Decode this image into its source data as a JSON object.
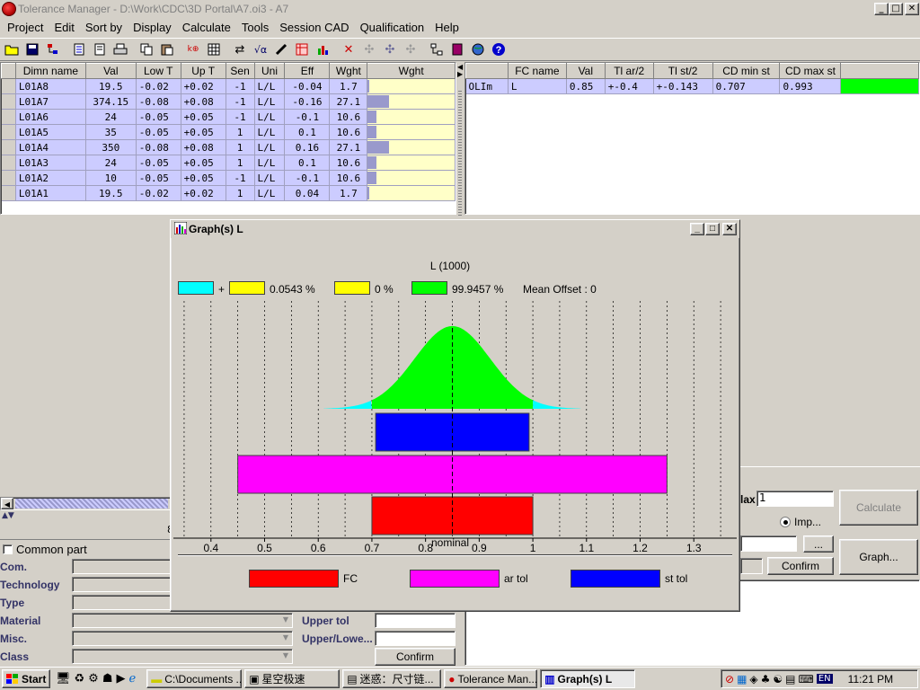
{
  "window": {
    "title": "Tolerance Manager - D:\\Work\\CDC\\3D Portal\\A7.oi3 - A7",
    "min": "_",
    "max": "□",
    "close": "✕"
  },
  "menu": [
    "Project",
    "Edit",
    "Sort by",
    "Display",
    "Calculate",
    "Tools",
    "Session CAD",
    "Qualification",
    "Help"
  ],
  "toolbar_icons": [
    "open-icon",
    "save-icon",
    "tree-icon",
    "print-preview-icon",
    "print-icon",
    "printer-icon",
    "copy-icon",
    "paste-icon",
    "tolerance-icon",
    "grid-icon",
    "swap-icon",
    "sqrt-icon",
    "ruler-icon",
    "table-icon",
    "chart-icon",
    "delete-icon",
    "disabled-icon-1",
    "disabled-icon-2",
    "disabled-icon-3",
    "network-icon",
    "book-icon",
    "globe-icon",
    "help-icon"
  ],
  "dims": {
    "headers": [
      "Dimn name",
      "Val",
      "Low T",
      "Up T",
      "Sen",
      "Uni",
      "Eff",
      "Wght",
      "Wght"
    ],
    "rows": [
      {
        "name": "L01A8",
        "val": "19.5",
        "low": "-0.02",
        "up": "+0.02",
        "sen": "-1",
        "uni": "L/L",
        "eff": "-0.04",
        "wght": "1.7",
        "bar": 0.017
      },
      {
        "name": "L01A7",
        "val": "374.15",
        "low": "-0.08",
        "up": "+0.08",
        "sen": "-1",
        "uni": "L/L",
        "eff": "-0.16",
        "wght": "27.1",
        "bar": 0.271
      },
      {
        "name": "L01A6",
        "val": "24",
        "low": "-0.05",
        "up": "+0.05",
        "sen": "-1",
        "uni": "L/L",
        "eff": "-0.1",
        "wght": "10.6",
        "bar": 0.106
      },
      {
        "name": "L01A5",
        "val": "35",
        "low": "-0.05",
        "up": "+0.05",
        "sen": "1",
        "uni": "L/L",
        "eff": "0.1",
        "wght": "10.6",
        "bar": 0.106
      },
      {
        "name": "L01A4",
        "val": "350",
        "low": "-0.08",
        "up": "+0.08",
        "sen": "1",
        "uni": "L/L",
        "eff": "0.16",
        "wght": "27.1",
        "bar": 0.271
      },
      {
        "name": "L01A3",
        "val": "24",
        "low": "-0.05",
        "up": "+0.05",
        "sen": "1",
        "uni": "L/L",
        "eff": "0.1",
        "wght": "10.6",
        "bar": 0.106
      },
      {
        "name": "L01A2",
        "val": "10",
        "low": "-0.05",
        "up": "+0.05",
        "sen": "-1",
        "uni": "L/L",
        "eff": "-0.1",
        "wght": "10.6",
        "bar": 0.106
      },
      {
        "name": "L01A1",
        "val": "19.5",
        "low": "-0.02",
        "up": "+0.02",
        "sen": "1",
        "uni": "L/L",
        "eff": "0.04",
        "wght": "1.7",
        "bar": 0.017
      }
    ]
  },
  "fc": {
    "headers": [
      "",
      "FC name",
      "Val",
      "Tl ar/2",
      "Tl st/2",
      "CD min st",
      "CD max st",
      ""
    ],
    "row": {
      "id": "OLIm",
      "name": "L",
      "val": "0.85",
      "tar": "+-0.4",
      "tst": "+-0.143",
      "cdmin": "0.707",
      "cdmax": "0.993",
      "status_color": "#00ff00"
    }
  },
  "graph": {
    "window_title": "Graph(s) L",
    "title": "L (1000)",
    "legend_top": {
      "plus": "+",
      "pct_out": "0.0543 %",
      "pct_yellow": "0 %",
      "pct_green": "99.9457 %",
      "mean_offset": "Mean Offset : 0"
    },
    "xlabel": "nominal",
    "legend_bottom": {
      "fc": "FC",
      "ar": "ar tol",
      "st": "st tol"
    },
    "colors": {
      "cyan": "#00ffff",
      "yellow": "#ffff00",
      "green": "#00ff00",
      "fc": "#ff0000",
      "ar": "#ff00ff",
      "st": "#0000ff"
    }
  },
  "chart_data": {
    "type": "bar",
    "title": "L (1000)",
    "xlabel": "nominal",
    "xlim": [
      0.33,
      1.38
    ],
    "xticks": [
      0.4,
      0.5,
      0.6,
      0.7,
      0.8,
      0.9,
      1,
      1.1,
      1.2,
      1.3
    ],
    "nominal": 0.85,
    "distribution": {
      "mean": 0.85,
      "sigma": 0.0705,
      "within_fraction": 0.999457,
      "out_fraction": 0.000543,
      "tail_start": 0.7,
      "tail_end": 1.0
    },
    "bars": [
      {
        "name": "st tol",
        "min": 0.707,
        "max": 0.993,
        "color": "#0000ff"
      },
      {
        "name": "ar tol",
        "min": 0.45,
        "max": 1.25,
        "color": "#ff00ff"
      },
      {
        "name": "FC",
        "min": 0.7,
        "max": 1.0,
        "color": "#ff0000"
      }
    ],
    "grid": true
  },
  "lower": {
    "common_part": "Common part",
    "labels": [
      "Com.",
      "Technology",
      "Type",
      "Material",
      "Misc.",
      "Class"
    ],
    "upper_tol": "Upper tol",
    "upper_lower": "Upper/Lowe...",
    "confirm": "Confirm",
    "num_partial": "8"
  },
  "right_panel": {
    "max_label": "lax",
    "max_value": "1",
    "calculate": "Calculate",
    "imp": "Imp...",
    "ellipsis": "...",
    "graph": "Graph...",
    "confirm": "Confirm"
  },
  "taskbar": {
    "start": "Start",
    "tasks": [
      "C:\\Documents ...",
      "星空极速",
      "迷惑：尺寸链...",
      "Tolerance Man...",
      "Graph(s) L"
    ],
    "lang": "EN",
    "clock": "11:21 PM"
  }
}
